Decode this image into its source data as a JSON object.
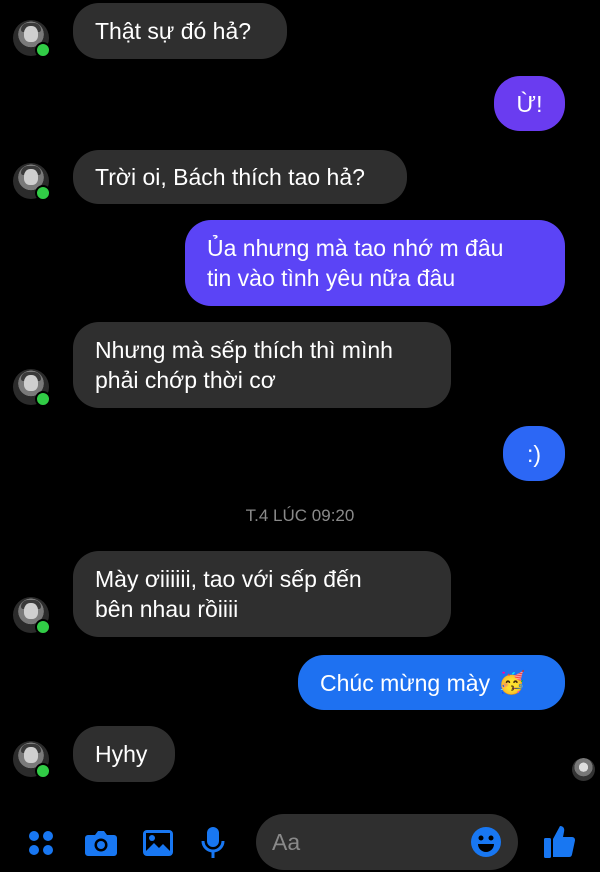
{
  "colors": {
    "background": "#000000",
    "incoming_bubble": "#2f2f2f",
    "accent": "#1877f2",
    "online": "#31cc46"
  },
  "messages": [
    {
      "side": "in",
      "text": "Thật sự đó hả?"
    },
    {
      "side": "out",
      "text": "Ừ!"
    },
    {
      "side": "in",
      "text": "Trời oi, Bách thích tao hả?"
    },
    {
      "side": "out",
      "text": "Ủa nhưng mà tao nhớ m đâu\ntin vào tình yêu nữa đâu"
    },
    {
      "side": "in",
      "text": "Nhưng mà sếp thích thì mình\nphải chớp thời cơ"
    },
    {
      "side": "out",
      "text": ":)"
    },
    {
      "side": "in",
      "text": "Mày ơiiiiii, tao với sếp đến\nbên nhau rồiiii"
    },
    {
      "side": "out",
      "text": "Chúc mừng mày",
      "emoji": "🥳"
    },
    {
      "side": "in",
      "text": "Hyhy"
    }
  ],
  "timestamp": "T.4 LÚC 09:20",
  "composer": {
    "placeholder": "Aa"
  },
  "icons": [
    "menu-dots-icon",
    "camera-icon",
    "image-icon",
    "microphone-icon",
    "emoji-icon",
    "like-icon"
  ]
}
